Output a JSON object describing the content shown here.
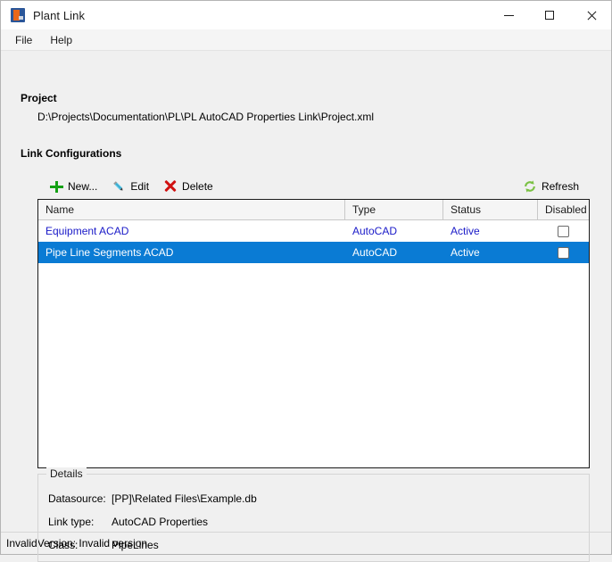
{
  "window": {
    "title": "Plant Link",
    "icon": "app-icon",
    "controls": {
      "minimize": "minimize-icon",
      "maximize": "maximize-icon",
      "close": "close-icon"
    }
  },
  "menubar": {
    "items": [
      {
        "label": "File"
      },
      {
        "label": "Help"
      }
    ]
  },
  "project": {
    "heading": "Project",
    "path": "D:\\Projects\\Documentation\\PL\\PL AutoCAD Properties Link\\Project.xml"
  },
  "link_configurations": {
    "heading": "Link Configurations",
    "toolbar": {
      "new_label": "New...",
      "edit_label": "Edit",
      "delete_label": "Delete",
      "refresh_label": "Refresh",
      "new_icon": "plus-icon",
      "edit_icon": "pencil-icon",
      "delete_icon": "x-icon",
      "refresh_icon": "refresh-icon"
    },
    "columns": [
      "Name",
      "Type",
      "Status",
      "Disabled"
    ],
    "rows": [
      {
        "name": "Equipment ACAD",
        "type": "AutoCAD",
        "status": "Active",
        "disabled": false,
        "selected": false
      },
      {
        "name": "Pipe Line Segments ACAD",
        "type": "AutoCAD",
        "status": "Active",
        "disabled": false,
        "selected": true
      }
    ]
  },
  "details": {
    "legend": "Details",
    "datasource_label": "Datasource:",
    "datasource_value": "[PP]\\Related Files\\Example.db",
    "linktype_label": "Link type:",
    "linktype_value": "AutoCAD Properties",
    "class_label": "Class:",
    "class_value": "PipeLines"
  },
  "statusbar": {
    "message": "InvalidVersion: Invalid version"
  },
  "colors": {
    "selection": "#0a7bd4",
    "link_text": "#1a1ac8",
    "accent_green": "#14a014",
    "accent_red": "#d01111"
  }
}
